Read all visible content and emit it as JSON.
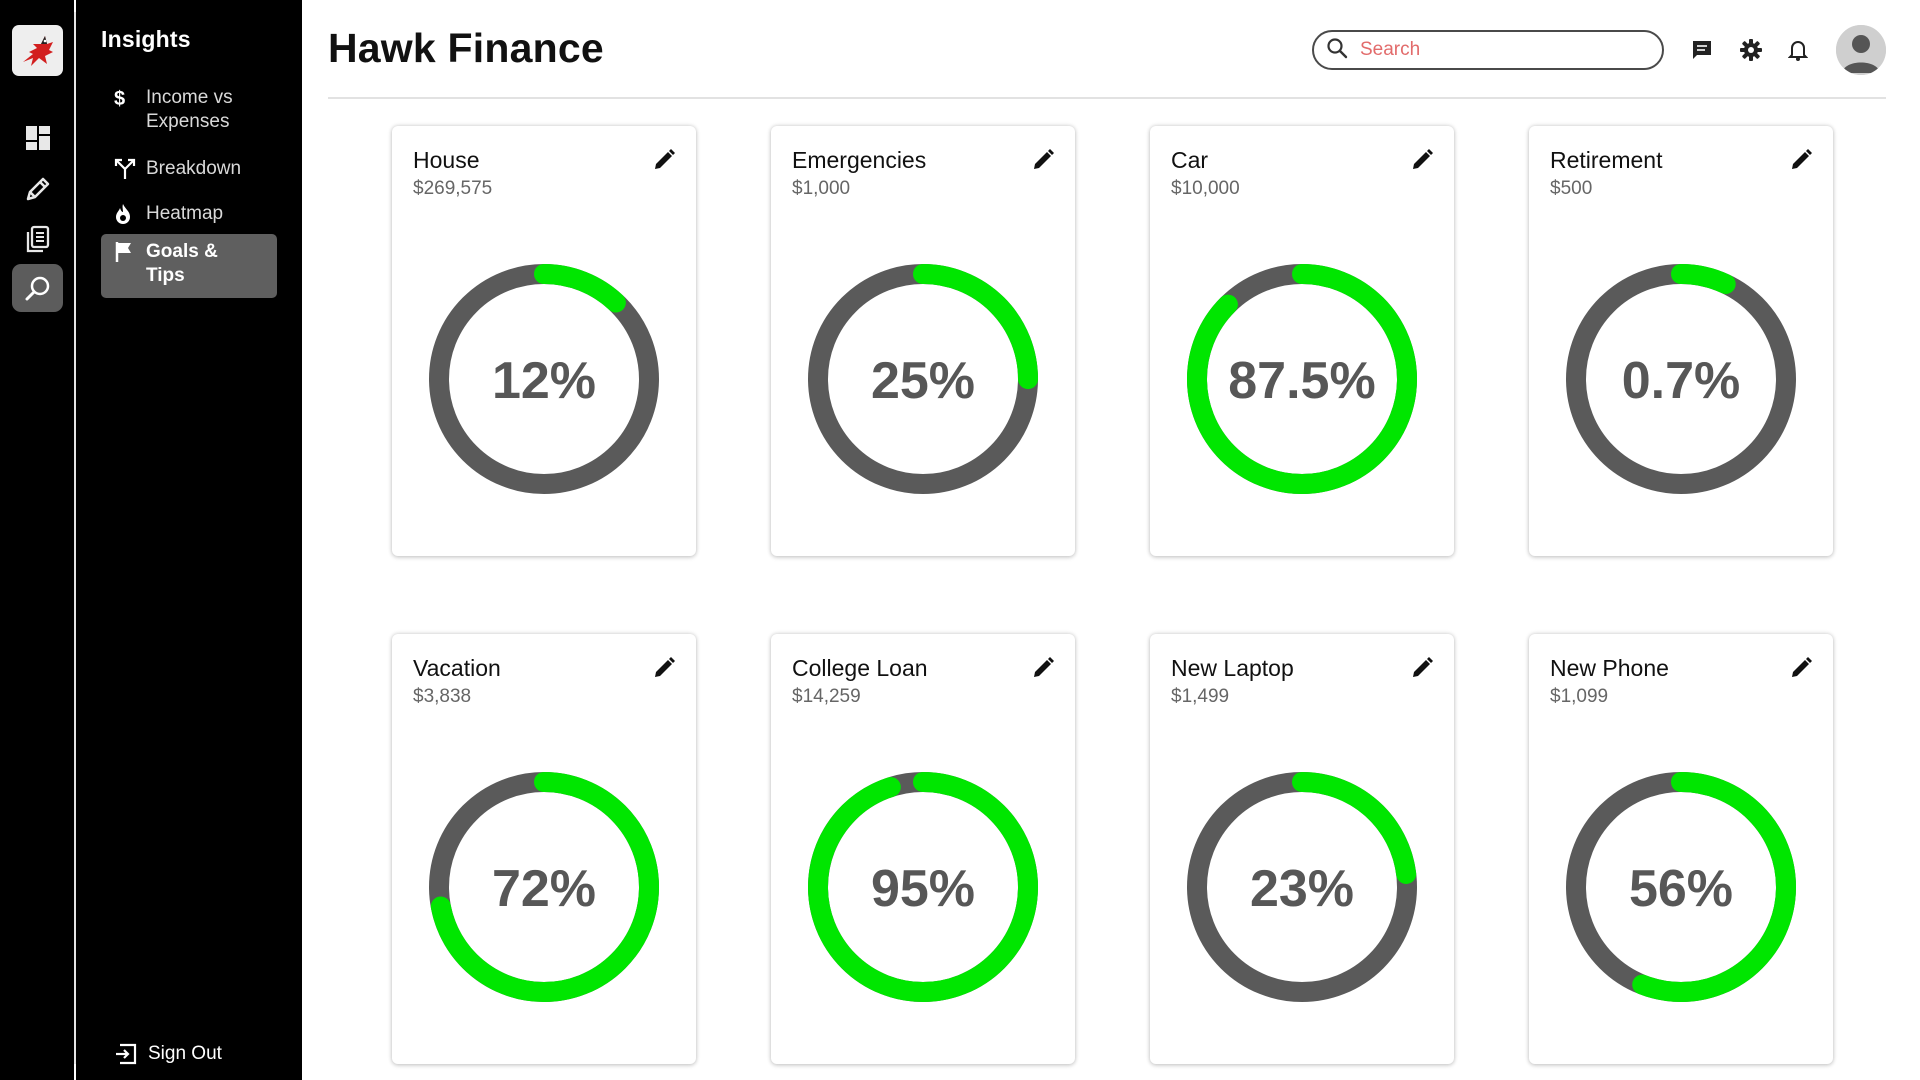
{
  "app": {
    "title": "Hawk Finance"
  },
  "sidebar": {
    "title": "Insights",
    "items": [
      {
        "label": "Income vs Expenses",
        "icon": "dollar-icon"
      },
      {
        "label": "Breakdown",
        "icon": "split-arrows-icon"
      },
      {
        "label": "Heatmap",
        "icon": "flame-icon"
      },
      {
        "label": "Goals & Tips",
        "icon": "flag-icon",
        "active": true
      }
    ],
    "signout_label": "Sign Out"
  },
  "rail": {
    "icons": [
      "hawk-logo-icon",
      "dashboard-icon",
      "pencil-icon",
      "documents-icon",
      "search-insights-icon"
    ],
    "active": "search-insights-icon"
  },
  "header": {
    "search": {
      "placeholder": "Search",
      "value": ""
    },
    "icons": [
      "chat-icon",
      "gear-icon",
      "bell-icon",
      "user-avatar-icon"
    ]
  },
  "colors": {
    "progress": "#00e600",
    "track": "#5a5a5a",
    "percent_text": "#575757",
    "search_placeholder": "#e26b6b"
  },
  "goals": [
    {
      "name": "House",
      "amount": "$269,575",
      "percent_label": "12%",
      "progress": 0.12
    },
    {
      "name": "Emergencies",
      "amount": "$1,000",
      "percent_label": "25%",
      "progress": 0.25
    },
    {
      "name": "Car",
      "amount": "$10,000",
      "percent_label": "87.5%",
      "progress": 0.875
    },
    {
      "name": "Retirement",
      "amount": "$500",
      "percent_label": "0.7%",
      "progress": 0.07
    },
    {
      "name": "Vacation",
      "amount": "$3,838",
      "percent_label": "72%",
      "progress": 0.72
    },
    {
      "name": "College Loan",
      "amount": "$14,259",
      "percent_label": "95%",
      "progress": 0.95
    },
    {
      "name": "New Laptop",
      "amount": "$1,499",
      "percent_label": "23%",
      "progress": 0.23
    },
    {
      "name": "New Phone",
      "amount": "$1,099",
      "percent_label": "56%",
      "progress": 0.56
    }
  ]
}
